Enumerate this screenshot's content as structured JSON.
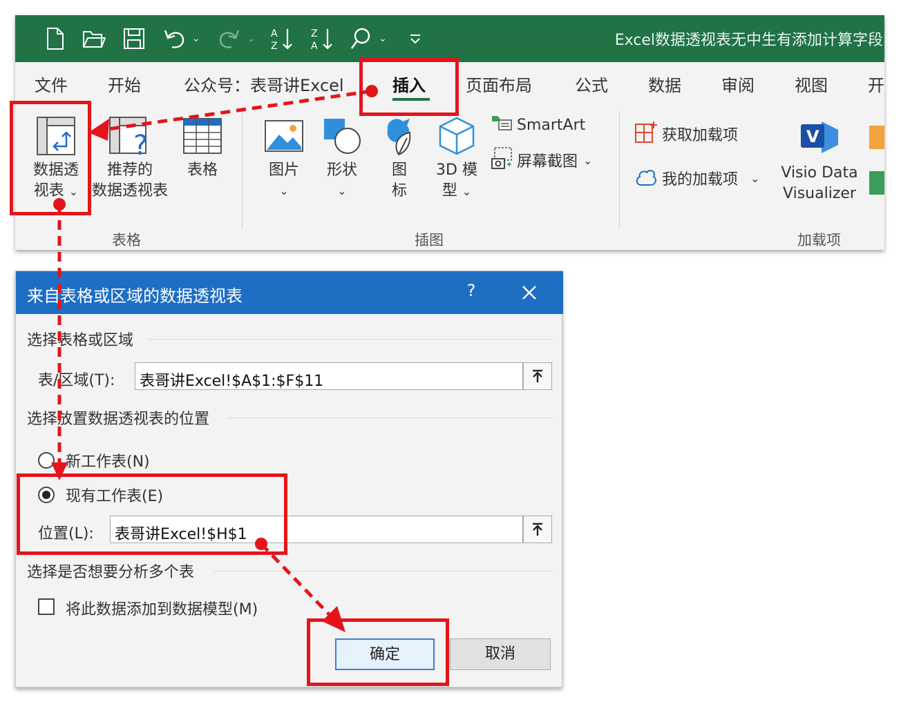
{
  "window": {
    "title": "Excel数据透视表无中生有添加计算字段"
  },
  "quick_access": {
    "icons": [
      "new-file-icon",
      "open-folder-icon",
      "save-icon",
      "undo-icon",
      "redo-icon",
      "sort-ascending-icon",
      "sort-descending-icon",
      "search-icon",
      "customize-qat-icon"
    ]
  },
  "tabs": [
    {
      "label": "文件"
    },
    {
      "label": "开始"
    },
    {
      "label": "公众号：表哥讲Excel"
    },
    {
      "label": "插入"
    },
    {
      "label": "页面布局"
    },
    {
      "label": "公式"
    },
    {
      "label": "数据"
    },
    {
      "label": "审阅"
    },
    {
      "label": "视图"
    },
    {
      "label": "开"
    }
  ],
  "ribbon": {
    "tables": {
      "group_label": "表格",
      "pivot_line1": "数据透",
      "pivot_line2": "视表",
      "recommended_line1": "推荐的",
      "recommended_line2": "数据透视表",
      "table_label": "表格"
    },
    "illustrations": {
      "group_label": "插图",
      "pictures": "图片",
      "shapes": "形状",
      "icons_line1": "图",
      "icons_line2": "标",
      "model_line1": "3D 模",
      "model_line2": "型",
      "smartart": "SmartArt",
      "screenshot": "屏幕截图"
    },
    "addins": {
      "group_label": "加载项",
      "get_addins": "获取加载项",
      "my_addins": "我的加载项",
      "visio_line1": "Visio Data",
      "visio_line2": "Visualizer"
    }
  },
  "dialog": {
    "title": "来自表格或区域的数据透视表",
    "help": "?",
    "section1": "选择表格或区域",
    "range_label": "表/区域(T):",
    "range_value": "表哥讲Excel!$A$1:$F$11",
    "section2": "选择放置数据透视表的位置",
    "new_sheet": "新工作表(N)",
    "existing_sheet": "现有工作表(E)",
    "location_label": "位置(L):",
    "location_value": "表哥讲Excel!$H$1",
    "section3": "选择是否想要分析多个表",
    "add_model": "将此数据添加到数据模型(M)",
    "ok": "确定",
    "cancel": "取消"
  },
  "colors": {
    "excel_green": "#217346",
    "dialog_blue": "#1e6ec4",
    "annotation_red": "#e5141b"
  }
}
